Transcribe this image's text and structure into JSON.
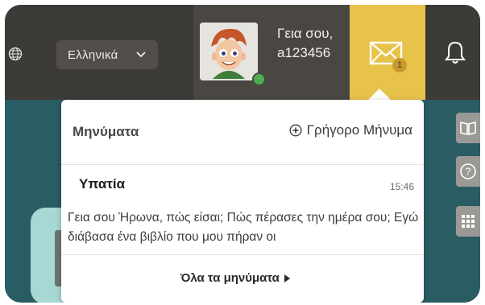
{
  "header": {
    "language": "Ελληνικά",
    "greeting_line1": "Γεια σου,",
    "username": "a123456",
    "mail_badge": "1"
  },
  "messages_panel": {
    "title": "Μηνύματα",
    "quick_message": "Γρήγορο Μήνυμα",
    "messages": [
      {
        "sender": "Υπατία",
        "time": "15:46",
        "preview": "Γεια σου Ήρωνα, πώς είσαι; Πώς πέρασες την ημέρα σου; Εγώ διάβασα ένα βιβλίο που μου πήραν οι"
      }
    ],
    "all_messages": "Όλα τα μηνύματα"
  },
  "colors": {
    "topbar": "#3d3b38",
    "user_block": "#4a4743",
    "mail_accent": "#e8c34a",
    "online": "#4caf50",
    "background": "#2a5c63"
  },
  "icons": [
    "globe-icon",
    "chevron-down-icon",
    "mail-icon",
    "bell-icon",
    "plus-circle-icon",
    "book-icon",
    "help-icon",
    "grid-icon"
  ]
}
